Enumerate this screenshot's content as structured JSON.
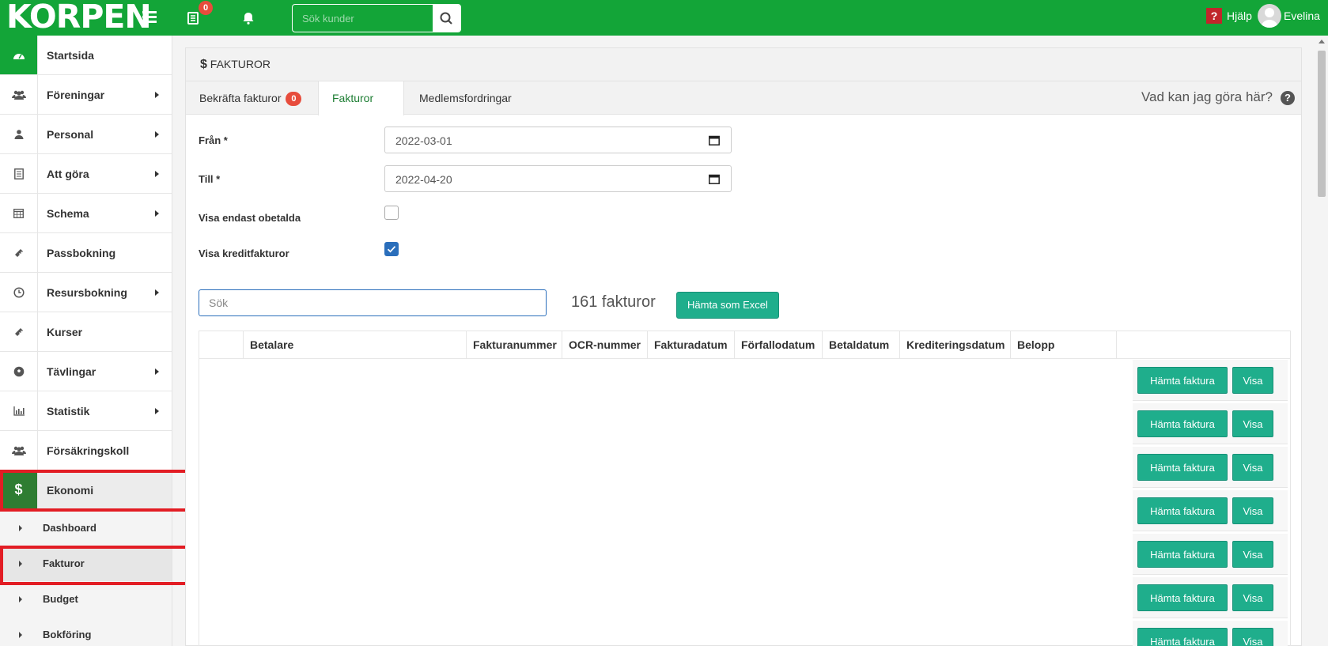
{
  "topbar": {
    "logo": "KORPEN",
    "notification_count": "0",
    "search_placeholder": "Sök kunder",
    "help_label": "Hjälp",
    "user_name": "Evelina"
  },
  "sidebar": {
    "items": [
      {
        "label": "Startsida",
        "icon": "dashboard-icon",
        "arrow": false
      },
      {
        "label": "Föreningar",
        "icon": "users-icon",
        "arrow": true
      },
      {
        "label": "Personal",
        "icon": "user-icon",
        "arrow": true
      },
      {
        "label": "Att göra",
        "icon": "list-icon",
        "arrow": true
      },
      {
        "label": "Schema",
        "icon": "calendar-icon",
        "arrow": true
      },
      {
        "label": "Passbokning",
        "icon": "ticket-icon",
        "arrow": false
      },
      {
        "label": "Resursbokning",
        "icon": "clock-icon",
        "arrow": true
      },
      {
        "label": "Kurser",
        "icon": "ticket-icon",
        "arrow": false
      },
      {
        "label": "Tävlingar",
        "icon": "soccer-ball-icon",
        "arrow": true
      },
      {
        "label": "Statistik",
        "icon": "bar-chart-icon",
        "arrow": true
      },
      {
        "label": "Försäkringskoll",
        "icon": "users-icon",
        "arrow": false
      },
      {
        "label": "Ekonomi",
        "icon": "dollar-icon",
        "arrow": false
      }
    ],
    "sub_items": [
      "Dashboard",
      "Fakturor",
      "Budget",
      "Bokföring"
    ]
  },
  "panel": {
    "title": "FAKTUROR",
    "tabs": {
      "confirm": "Bekräfta fakturor",
      "confirm_badge": "0",
      "invoices": "Fakturor",
      "member_claims": "Medlemsfordringar"
    },
    "help_text": "Vad kan jag göra här?"
  },
  "form": {
    "from_label": "Från *",
    "from_value": "2022-03-01",
    "to_label": "Till *",
    "to_value": "2022-04-20",
    "unpaid_label": "Visa endast obetalda",
    "unpaid_checked": false,
    "credit_label": "Visa kreditfakturor",
    "credit_checked": true
  },
  "list": {
    "search_placeholder": "Sök",
    "count": "161 fakturor",
    "excel_button": "Hämta som Excel",
    "columns": [
      "Betalare",
      "Fakturanummer",
      "OCR-nummer",
      "Fakturadatum",
      "Förfallodatum",
      "Betaldatum",
      "Krediteringsdatum",
      "Belopp"
    ],
    "row_buttons": {
      "download": "Hämta faktura",
      "view": "Visa"
    },
    "rows_visible": 7
  },
  "colors": {
    "brand_green": "#13a538",
    "action_teal": "#1fae8c",
    "badge_red": "#e74c3c",
    "highlight_red": "#e21d24"
  }
}
